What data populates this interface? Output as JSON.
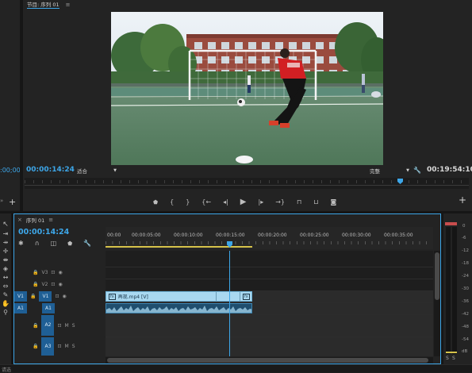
{
  "source_panel": {
    "timecode": ":00;00",
    "add_button": "+"
  },
  "program_monitor": {
    "title": "节目: 序列 01",
    "menu_icon": "hamburger-icon",
    "timecode_left": "00:00:14:24",
    "fit_label": "适合",
    "quality_label": "完整",
    "timecode_right": "00:19:54:10",
    "video_scene": "football goalkeeper in red kit on artificial turf field, goal net and brick building behind"
  },
  "transport": {
    "buttons": [
      "marker-icon",
      "in-point-icon",
      "out-point-icon",
      "go-to-in-icon",
      "step-back-icon",
      "play-icon",
      "step-forward-icon",
      "go-to-out-icon",
      "lift-icon",
      "extract-icon",
      "camera-icon"
    ],
    "add_button": "+"
  },
  "timeline": {
    "tab_title": "序列 01",
    "close": "×",
    "menu_icon": "hamburger-icon",
    "timecode": "00:00:14:24",
    "ruler": [
      "00:00",
      "00:00:05:00",
      "00:00:10:00",
      "00:00:15:00",
      "00:00:20:00",
      "00:00:25:00",
      "00:00:30:00",
      "00:00:35:00"
    ],
    "tracks": {
      "v3": "V3",
      "v2": "V2",
      "v1_src": "V1",
      "v1": "V1",
      "a1_src": "A1",
      "a1": "A1",
      "a2": "A2",
      "a3": "A3",
      "m": "M",
      "s": "S"
    },
    "clip_label": "再现.mp4 [V]",
    "fx_label": "fx"
  },
  "audio_meter": {
    "labels": [
      "0",
      "-6",
      "-12",
      "-18",
      "-24",
      "-30",
      "-36",
      "-42",
      "-48",
      "-54",
      "dB"
    ],
    "solo": [
      "S",
      "S"
    ]
  },
  "status_bar": {
    "text": "请选"
  },
  "colors": {
    "accent": "#3da6e8",
    "clip_video": "#a9d8f0",
    "clip_audio": "#1f4e6e",
    "track_src": "#1f5f95",
    "bg": "#232323"
  }
}
